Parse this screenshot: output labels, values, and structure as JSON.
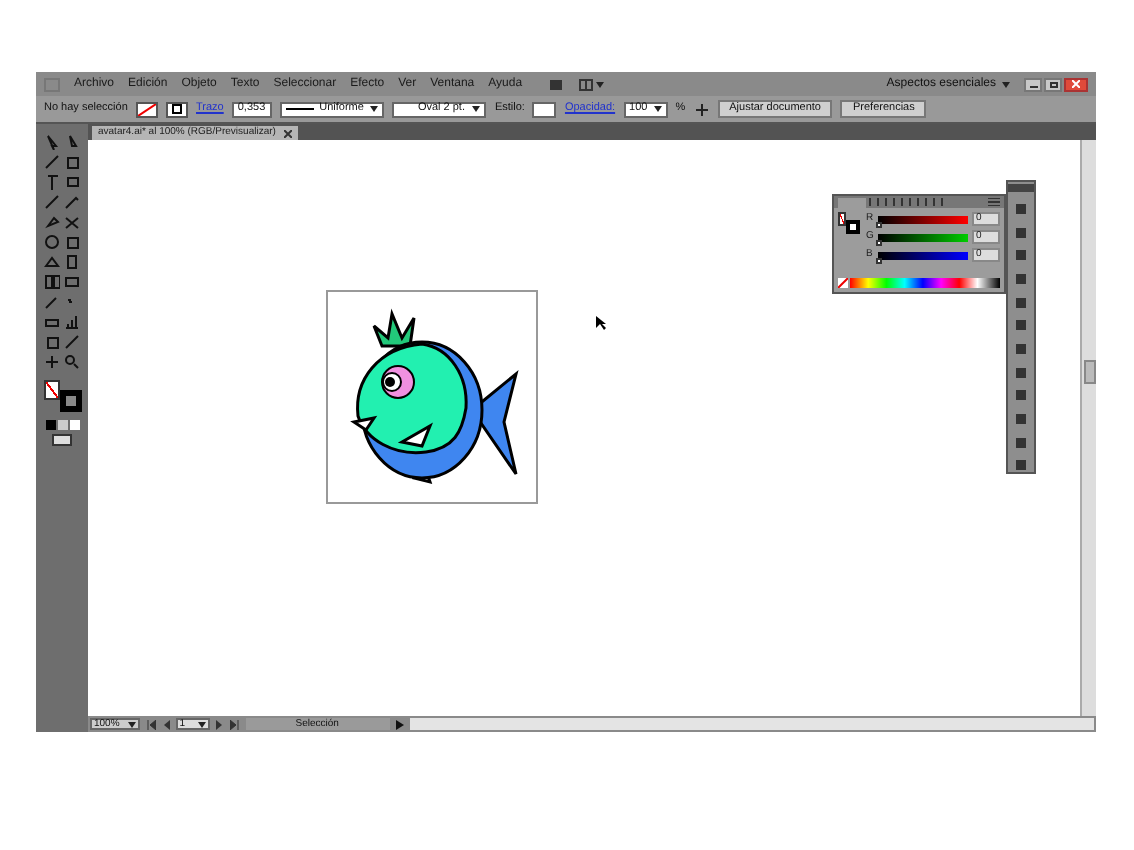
{
  "menu_bar": {
    "items": [
      "Archivo",
      "Edición",
      "Objeto",
      "Texto",
      "Seleccionar",
      "Efecto",
      "Ver",
      "Ventana",
      "Ayuda"
    ],
    "workspace": "Aspectos esenciales"
  },
  "control_bar": {
    "selection": "No hay selección",
    "stroke_label": "Trazo",
    "stroke_weight": "0,353",
    "stroke_profile": "Uniforme",
    "brush": "Oval 2 pt.",
    "style_label": "Estilo:",
    "opacity_label": "Opacidad:",
    "opacity": "100",
    "percent": "%",
    "buttons": [
      "Ajustar documento",
      "Preferencias"
    ]
  },
  "document_tab": {
    "title": "avatar4.ai* al 100% (RGB/Previsualizar)"
  },
  "color_panel": {
    "channels": [
      {
        "name": "R",
        "value": "0",
        "level": 0
      },
      {
        "name": "G",
        "value": "0",
        "level": 0
      },
      {
        "name": "B",
        "value": "0",
        "level": 0
      }
    ]
  },
  "status_bar": {
    "zoom": "100%",
    "page": "1",
    "tool": "Selección"
  }
}
